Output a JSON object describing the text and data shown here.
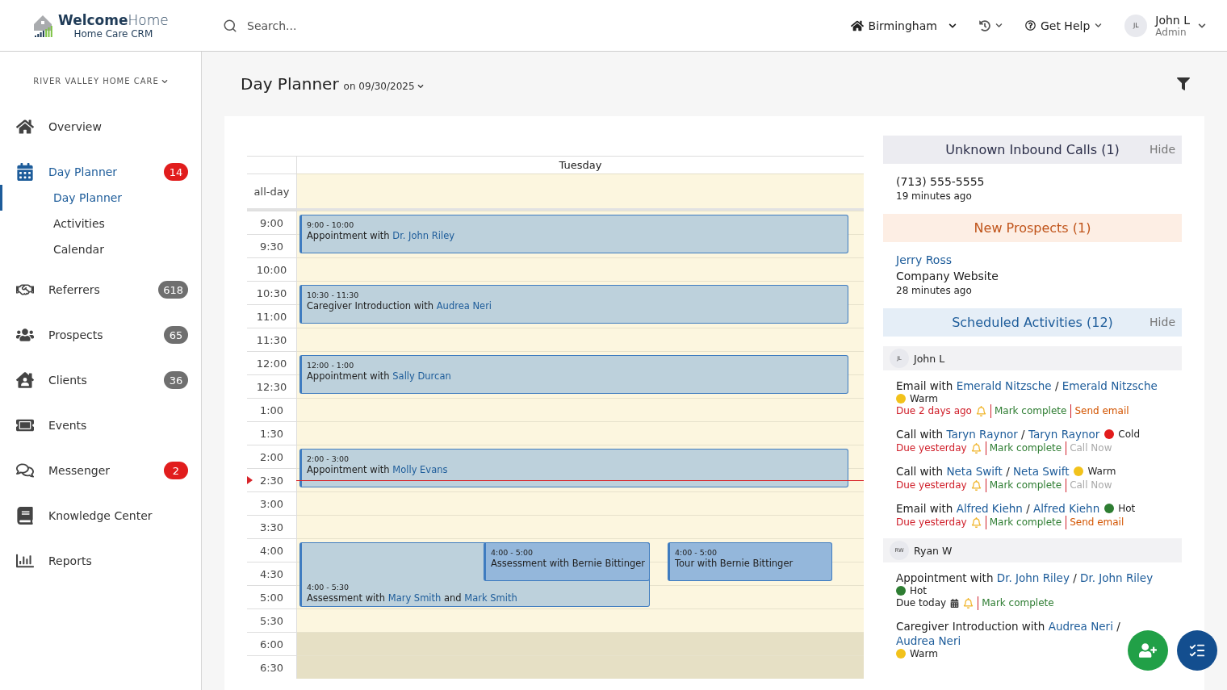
{
  "header": {
    "logo": {
      "brand_bold": "Welcome",
      "brand_light": "Home",
      "tagline": "Home Care CRM"
    },
    "search": {
      "placeholder": "Search..."
    },
    "location": "Birmingham",
    "help": "Get Help",
    "user": {
      "initials": "JL",
      "name": "John L",
      "role": "Admin"
    }
  },
  "sidebar": {
    "organization": "RIVER VALLEY HOME CARE",
    "items": [
      {
        "label": "Overview",
        "selected": false
      },
      {
        "label": "Day Planner",
        "selected": true,
        "badge": "14",
        "alert": true,
        "children": [
          {
            "label": "Day Planner",
            "selected": true
          },
          {
            "label": "Activities",
            "selected": false
          },
          {
            "label": "Calendar",
            "selected": false
          }
        ]
      },
      {
        "label": "Referrers",
        "selected": false,
        "badge": "618",
        "alert": false
      },
      {
        "label": "Prospects",
        "selected": false,
        "badge": "65",
        "alert": false
      },
      {
        "label": "Clients",
        "selected": false,
        "badge": "36",
        "alert": false
      },
      {
        "label": "Events",
        "selected": false
      },
      {
        "label": "Messenger",
        "selected": false,
        "badge": "2",
        "alert": true
      },
      {
        "label": "Knowledge Center",
        "selected": false
      },
      {
        "label": "Reports",
        "selected": false
      }
    ]
  },
  "planner": {
    "title": "Day Planner",
    "date": "on 09/30/2025",
    "calendar": {
      "day": "Tuesday",
      "all_day_label": "all-day",
      "slots": [
        {
          "time": "9:00",
          "after_hours": false
        },
        {
          "time": "9:30",
          "after_hours": false
        },
        {
          "time": "10:00",
          "after_hours": false
        },
        {
          "time": "10:30",
          "after_hours": false
        },
        {
          "time": "11:00",
          "after_hours": false
        },
        {
          "time": "11:30",
          "after_hours": false
        },
        {
          "time": "12:00",
          "after_hours": false
        },
        {
          "time": "12:30",
          "after_hours": false
        },
        {
          "time": "1:00",
          "after_hours": false
        },
        {
          "time": "1:30",
          "after_hours": false
        },
        {
          "time": "2:00",
          "after_hours": false
        },
        {
          "time": "2:30",
          "after_hours": false
        },
        {
          "time": "3:00",
          "after_hours": false
        },
        {
          "time": "3:30",
          "after_hours": false
        },
        {
          "time": "4:00",
          "after_hours": false
        },
        {
          "time": "4:30",
          "after_hours": false
        },
        {
          "time": "5:00",
          "after_hours": false
        },
        {
          "time": "5:30",
          "after_hours": false
        },
        {
          "time": "6:00",
          "after_hours": true
        },
        {
          "time": "6:30",
          "after_hours": true
        }
      ],
      "events": [
        {
          "time": "9:00 - 10:00",
          "highlighted": false,
          "parts": [
            {
              "text": "Appointment with ",
              "kind": "text"
            },
            {
              "text": "Dr. John Riley",
              "kind": "link"
            }
          ]
        },
        {
          "time": "10:30 - 11:30",
          "highlighted": false,
          "parts": [
            {
              "text": "Caregiver Introduction with ",
              "kind": "text"
            },
            {
              "text": "Audrea Neri",
              "kind": "link"
            }
          ]
        },
        {
          "time": "12:00 - 1:00",
          "highlighted": false,
          "parts": [
            {
              "text": "Appointment with ",
              "kind": "text"
            },
            {
              "text": "Sally Durcan",
              "kind": "link"
            }
          ]
        },
        {
          "time": "2:00 - 3:00",
          "highlighted": false,
          "parts": [
            {
              "text": "Appointment with ",
              "kind": "text"
            },
            {
              "text": "Molly Evans",
              "kind": "link"
            }
          ]
        },
        {
          "time": "4:00 - 5:30",
          "highlighted": false,
          "parts": [
            {
              "text": "Assessment with ",
              "kind": "text"
            },
            {
              "text": "Mary Smith",
              "kind": "link"
            },
            {
              "text": " and ",
              "kind": "text"
            },
            {
              "text": "Mark Smith",
              "kind": "link"
            }
          ]
        },
        {
          "time": "4:00 - 5:00",
          "highlighted": true,
          "parts": [
            {
              "text": "Assessment with Bernie Bittinger",
              "kind": "text"
            }
          ]
        },
        {
          "time": "4:00 - 5:00",
          "highlighted": true,
          "parts": [
            {
              "text": "Tour with Bernie Bittinger",
              "kind": "text"
            }
          ]
        }
      ]
    }
  },
  "panel": {
    "sections": [
      {
        "kind": "calls",
        "title": "Unknown Inbound Calls (1)",
        "hide": "Hide",
        "items": [
          {
            "lines": [
              {
                "text": "(713) 555-5555",
                "kind": "main"
              },
              {
                "text": "19 minutes ago",
                "kind": "time"
              }
            ]
          }
        ]
      },
      {
        "kind": "prospects",
        "title": "New Prospects (1)",
        "items": [
          {
            "lines": [
              {
                "text": "Jerry Ross",
                "kind": "link"
              },
              {
                "text": "Company Website",
                "kind": "main"
              },
              {
                "text": "28 minutes ago",
                "kind": "time"
              }
            ]
          }
        ]
      },
      {
        "kind": "activities",
        "title": "Scheduled Activities (12)",
        "hide": "Hide",
        "groups": [
          {
            "initials": "JL",
            "name": "John L",
            "activities": [
              {
                "parts": [
                  {
                    "text": "Email with ",
                    "kind": "text"
                  },
                  {
                    "text": "Emerald Nitzsche",
                    "kind": "link"
                  },
                  {
                    "text": " / ",
                    "kind": "text"
                  },
                  {
                    "text": "Emerald Nitzsche",
                    "kind": "link"
                  }
                ],
                "temperature": "Warm",
                "color": "#f2c21b",
                "due": "Due 2 days ago",
                "overdue": true,
                "kind": "task",
                "actions": [
                  {
                    "label": "Mark complete",
                    "kind": "complete",
                    "disabled": false
                  },
                  {
                    "label": "Send email",
                    "kind": "email",
                    "disabled": false
                  }
                ]
              },
              {
                "parts": [
                  {
                    "text": "Call with ",
                    "kind": "text"
                  },
                  {
                    "text": "Taryn Raynor",
                    "kind": "link"
                  },
                  {
                    "text": " / ",
                    "kind": "text"
                  },
                  {
                    "text": "Taryn Raynor",
                    "kind": "link"
                  }
                ],
                "temperature": "Cold",
                "color": "#e21c1c",
                "due": "Due yesterday",
                "overdue": true,
                "kind": "task",
                "actions": [
                  {
                    "label": "Mark complete",
                    "kind": "complete",
                    "disabled": false
                  },
                  {
                    "label": "Call Now",
                    "kind": "call",
                    "disabled": true
                  }
                ]
              },
              {
                "parts": [
                  {
                    "text": "Call with ",
                    "kind": "text"
                  },
                  {
                    "text": "Neta Swift",
                    "kind": "link"
                  },
                  {
                    "text": " / ",
                    "kind": "text"
                  },
                  {
                    "text": "Neta Swift",
                    "kind": "link"
                  }
                ],
                "temperature": "Warm",
                "color": "#f2c21b",
                "due": "Due yesterday",
                "overdue": true,
                "kind": "task",
                "actions": [
                  {
                    "label": "Mark complete",
                    "kind": "complete",
                    "disabled": false
                  },
                  {
                    "label": "Call Now",
                    "kind": "call",
                    "disabled": true
                  }
                ]
              },
              {
                "parts": [
                  {
                    "text": "Email with ",
                    "kind": "text"
                  },
                  {
                    "text": "Alfred Kiehn",
                    "kind": "link"
                  },
                  {
                    "text": " / ",
                    "kind": "text"
                  },
                  {
                    "text": "Alfred Kiehn",
                    "kind": "link"
                  }
                ],
                "temperature": "Hot",
                "color": "#2e7d32",
                "due": "Due yesterday",
                "overdue": true,
                "kind": "task",
                "actions": [
                  {
                    "label": "Mark complete",
                    "kind": "complete",
                    "disabled": false
                  },
                  {
                    "label": "Send email",
                    "kind": "email",
                    "disabled": false
                  }
                ]
              }
            ]
          },
          {
            "initials": "RW",
            "name": "Ryan W",
            "activities": [
              {
                "parts": [
                  {
                    "text": "Appointment with ",
                    "kind": "text"
                  },
                  {
                    "text": "Dr. John Riley",
                    "kind": "link"
                  },
                  {
                    "text": " / ",
                    "kind": "text"
                  },
                  {
                    "text": "Dr. John Riley",
                    "kind": "link"
                  }
                ],
                "temperature": "Hot",
                "color": "#2e7d32",
                "due": "Due today",
                "overdue": false,
                "kind": "appointment",
                "actions": [
                  {
                    "label": "Mark complete",
                    "kind": "complete",
                    "disabled": false
                  }
                ]
              },
              {
                "parts": [
                  {
                    "text": "Caregiver Introduction with ",
                    "kind": "text"
                  },
                  {
                    "text": "Audrea Neri",
                    "kind": "link"
                  },
                  {
                    "text": " / ",
                    "kind": "text"
                  },
                  {
                    "text": "Audrea Neri",
                    "kind": "link"
                  }
                ],
                "temperature": "Warm",
                "color": "#f2c21b"
              }
            ]
          }
        ]
      }
    ]
  }
}
